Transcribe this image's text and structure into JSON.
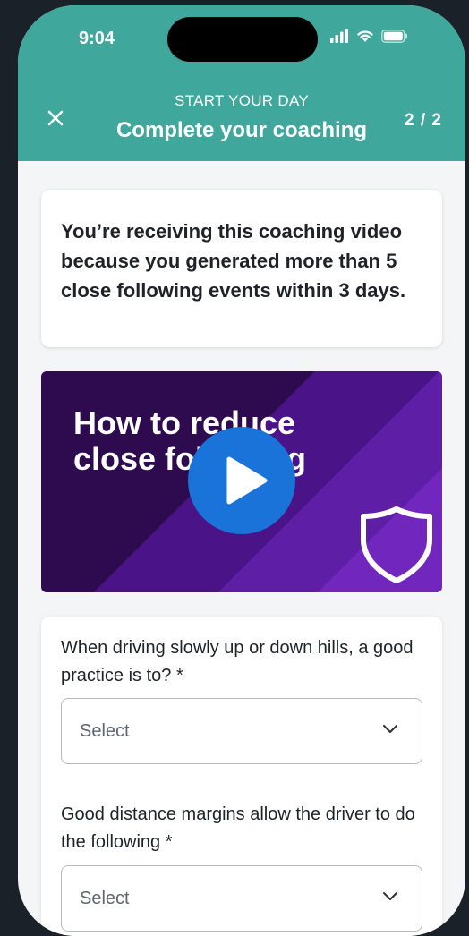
{
  "status_bar": {
    "time": "9:04",
    "icons": [
      "signal-icon",
      "wifi-icon",
      "battery-icon"
    ]
  },
  "header": {
    "subtitle": "START YOUR DAY",
    "title": "Complete your coaching",
    "step": "2 / 2",
    "close_icon": "close-icon"
  },
  "info_card": {
    "text": "You’re receiving this coaching video because you generated more than 5 close following events within 3 days."
  },
  "video": {
    "title_line1": "How to reduce",
    "title_line2": "close following",
    "play_icon": "play-icon",
    "shield_icon": "shield-icon"
  },
  "questions": [
    {
      "label": "When driving slowly up or down hills, a good practice is to? *",
      "value": "Select"
    },
    {
      "label": "Good distance margins allow the driver to do the following *",
      "value": "Select"
    }
  ],
  "colors": {
    "header": "#3fa79b",
    "video_dark": "#2d0b4e",
    "play": "#1a73d9"
  }
}
